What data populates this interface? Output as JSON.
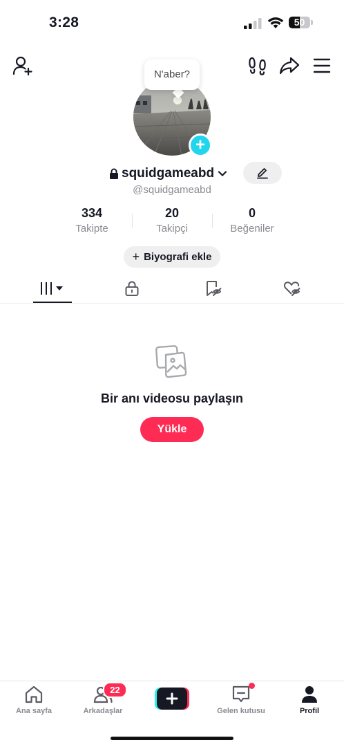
{
  "status_bar": {
    "time": "3:28",
    "battery": "50"
  },
  "speech_bubble": "N'aber?",
  "profile": {
    "username": "squidgameabd",
    "handle": "@squidgameabd"
  },
  "stats": [
    {
      "value": "334",
      "label": "Takipte"
    },
    {
      "value": "20",
      "label": "Takipçi"
    },
    {
      "value": "0",
      "label": "Beğeniler"
    }
  ],
  "bio_button": "Biyografi ekle",
  "tabs": [
    {
      "icon": "grid-videos-icon"
    },
    {
      "icon": "lock-icon"
    },
    {
      "icon": "saved-icon"
    },
    {
      "icon": "liked-icon"
    }
  ],
  "empty_state": {
    "title": "Bir anı videosu paylaşın",
    "button": "Yükle"
  },
  "bottom_nav": {
    "items": [
      {
        "label": "Ana sayfa"
      },
      {
        "label": "Arkadaşlar"
      },
      {
        "label": "Gelen kutusu"
      },
      {
        "label": "Profil"
      }
    ],
    "friends_badge": "22"
  },
  "colors": {
    "accent": "#fe2c55",
    "cyan": "#20d5ec",
    "text": "#161823",
    "muted": "#8a8b91"
  }
}
